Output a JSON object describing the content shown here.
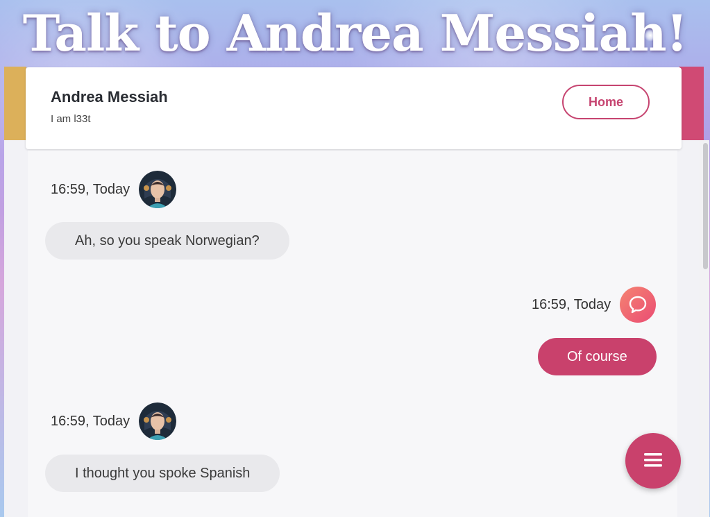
{
  "banner": {
    "title": "Talk to Andrea Messiah!"
  },
  "header": {
    "name": "Andrea Messiah",
    "status": "I am l33t",
    "home_label": "Home"
  },
  "messages": [
    {
      "sender": "bot",
      "time": "16:59, Today",
      "text": "Ah, so you speak Norwegian?"
    },
    {
      "sender": "user",
      "time": "16:59, Today",
      "text": "Of course"
    },
    {
      "sender": "bot",
      "time": "16:59, Today",
      "text": "I thought you spoke Spanish"
    }
  ],
  "icons": {
    "bot_avatar": "avatar",
    "user_avatar": "chat-bubble-icon",
    "fab": "menu-icon"
  },
  "colors": {
    "accent": "#c9416c",
    "banner_left": "#dcb05a",
    "banner_right": "#d04a74",
    "bubble_in": "#e9e9ec"
  }
}
